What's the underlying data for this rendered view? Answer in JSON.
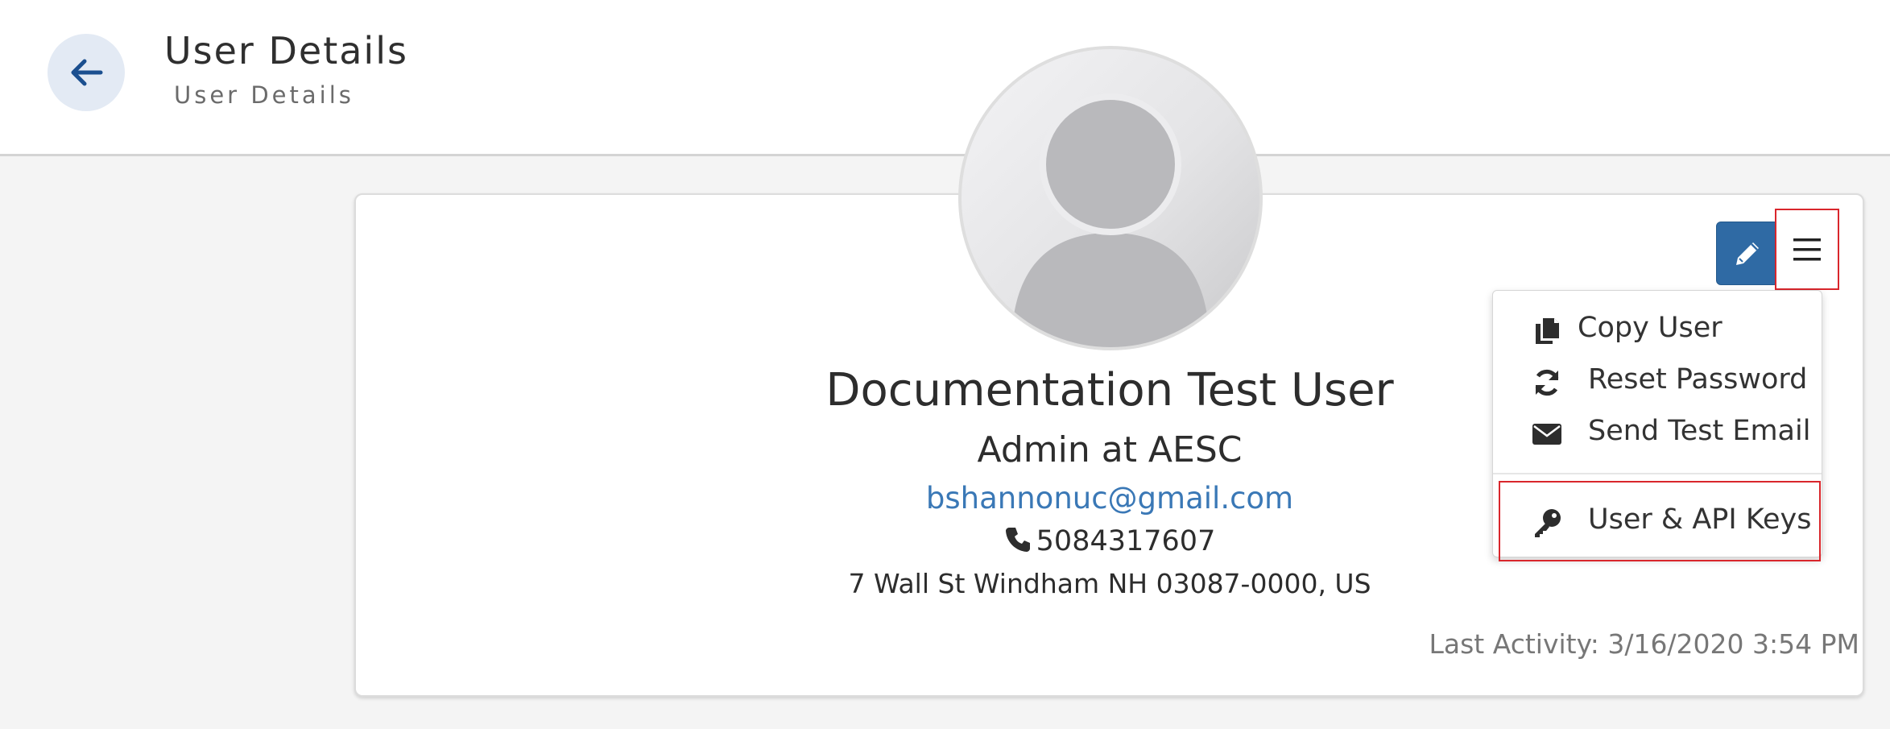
{
  "header": {
    "title": "User Details",
    "subtitle": "User Details",
    "back_icon": "arrow-left-icon"
  },
  "profile": {
    "avatar_icon": "user-placeholder-icon",
    "name": "Documentation Test User",
    "role": "Admin at AESC",
    "email": "bshannonuc@gmail.com",
    "phone": "5084317607",
    "address": "7 Wall St Windham NH 03087-0000, US",
    "last_activity": "Last Activity: 3/16/2020 3:54 PM"
  },
  "actions": {
    "edit_icon": "pencil-icon",
    "menu_icon": "hamburger-icon"
  },
  "menu": {
    "items": [
      {
        "label": "Copy User",
        "icon": "copy-icon"
      },
      {
        "label": "Reset Password",
        "icon": "refresh-icon"
      },
      {
        "label": "Send Test Email",
        "icon": "envelope-icon"
      },
      {
        "label": "User & API Keys",
        "icon": "key-icon"
      }
    ]
  },
  "colors": {
    "accent": "#2f6aa4",
    "link": "#3a78b6",
    "highlight": "#d9262c"
  }
}
